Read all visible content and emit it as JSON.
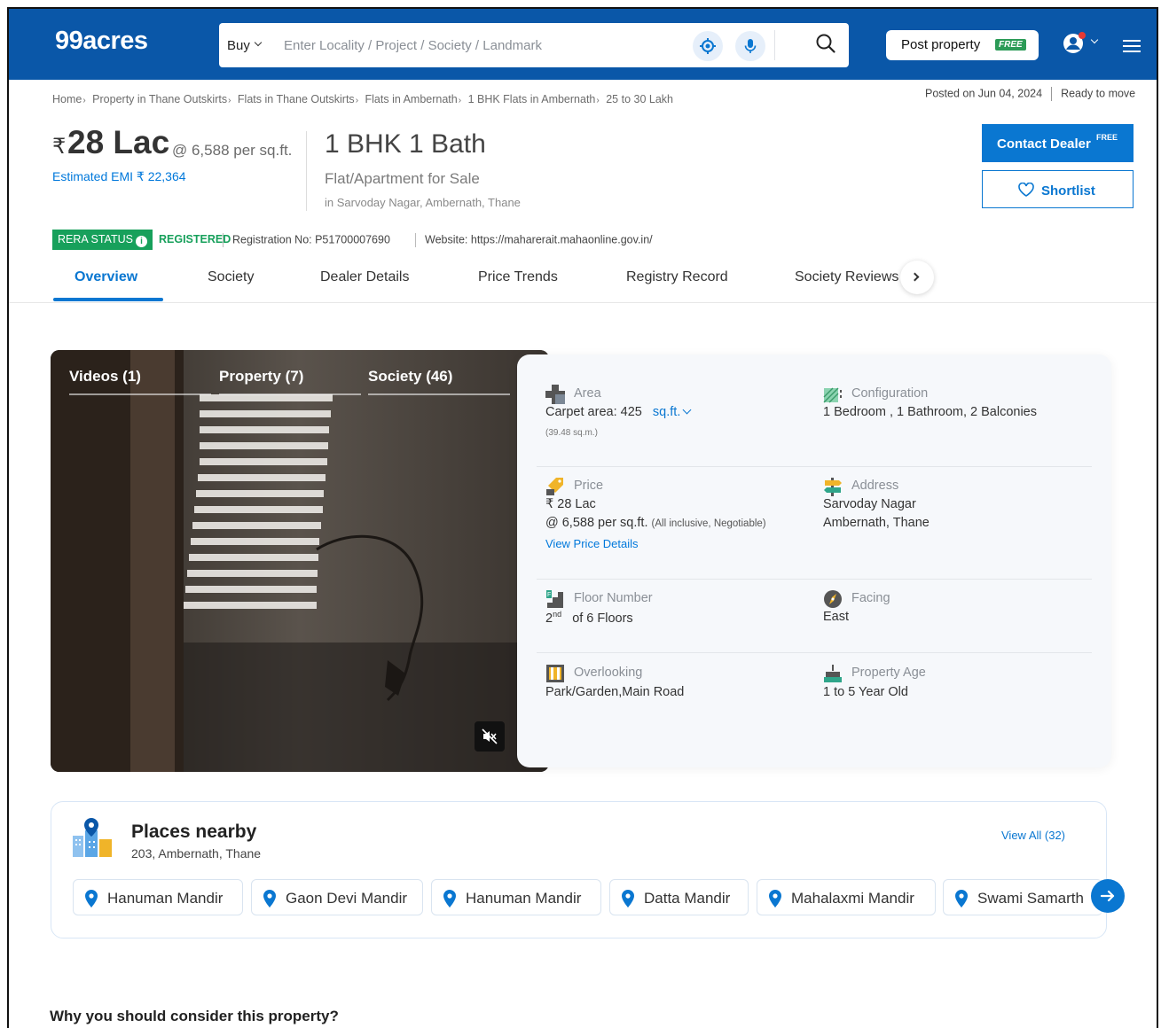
{
  "header": {
    "logo": "99acres",
    "search": {
      "mode": "Buy",
      "placeholder": "Enter Locality / Project / Society / Landmark"
    },
    "post_property": "Post property",
    "post_badge": "FREE"
  },
  "breadcrumb": [
    "Home",
    "Property in Thane Outskirts",
    "Flats in Thane Outskirts",
    "Flats in Ambernath",
    "1 BHK Flats in Ambernath",
    "25 to 30 Lakh"
  ],
  "meta": {
    "posted": "Posted on Jun 04, 2024",
    "status": "Ready to move"
  },
  "listing": {
    "rupee": "₹",
    "price": "28 Lac",
    "per_sqft": "@ 6,588 per sq.ft.",
    "emi": "Estimated EMI ₹ 22,364",
    "title": "1 BHK 1 Bath",
    "subtitle": "Flat/Apartment for Sale",
    "location": "in Sarvoday Nagar, Ambernath, Thane"
  },
  "actions": {
    "contact": "Contact Dealer",
    "contact_sup": "FREE",
    "shortlist": "Shortlist"
  },
  "rera": {
    "badge": "RERA STATUS",
    "status": "REGISTERED",
    "registration": "Registration No: P51700007690",
    "website": "Website: https://maharerait.mahaonline.gov.in/"
  },
  "tabs": [
    "Overview",
    "Society",
    "Dealer Details",
    "Price Trends",
    "Registry Record",
    "Society Reviews"
  ],
  "media": {
    "tabs": [
      "Videos (1)",
      "Property (7)",
      "Society (46)"
    ]
  },
  "details": {
    "area": {
      "label": "Area",
      "value": "Carpet area: 425",
      "unit": "sq.ft.",
      "sub": "(39.48 sq.m.)"
    },
    "configuration": {
      "label": "Configuration",
      "value": "1 Bedroom , 1 Bathroom, 2 Balconies"
    },
    "price": {
      "label": "Price",
      "value": "₹ 28 Lac",
      "per": "@ 6,588 per sq.ft.",
      "note": "(All inclusive, Negotiable)",
      "link": "View Price Details"
    },
    "address": {
      "label": "Address",
      "line1": "Sarvoday Nagar",
      "line2": "Ambernath, Thane"
    },
    "floor": {
      "label": "Floor Number",
      "floor": "2",
      "sup": "nd",
      "total": "of 6 Floors"
    },
    "facing": {
      "label": "Facing",
      "value": "East"
    },
    "overlooking": {
      "label": "Overlooking",
      "value": "Park/Garden,Main Road"
    },
    "age": {
      "label": "Property Age",
      "value": "1 to 5 Year Old"
    }
  },
  "places": {
    "title": "Places nearby",
    "subtitle": "203, Ambernath, Thane",
    "view_all": "View All (32)",
    "items": [
      "Hanuman Mandir",
      "Gaon Devi Mandir",
      "Hanuman Mandir",
      "Datta Mandir",
      "Mahalaxmi Mandir",
      "Swami Samarth"
    ]
  },
  "why_heading": "Why you should consider this property?",
  "colors": {
    "brand_blue": "#0a57a8",
    "accent": "#0a77d1",
    "green": "#17a05b"
  }
}
